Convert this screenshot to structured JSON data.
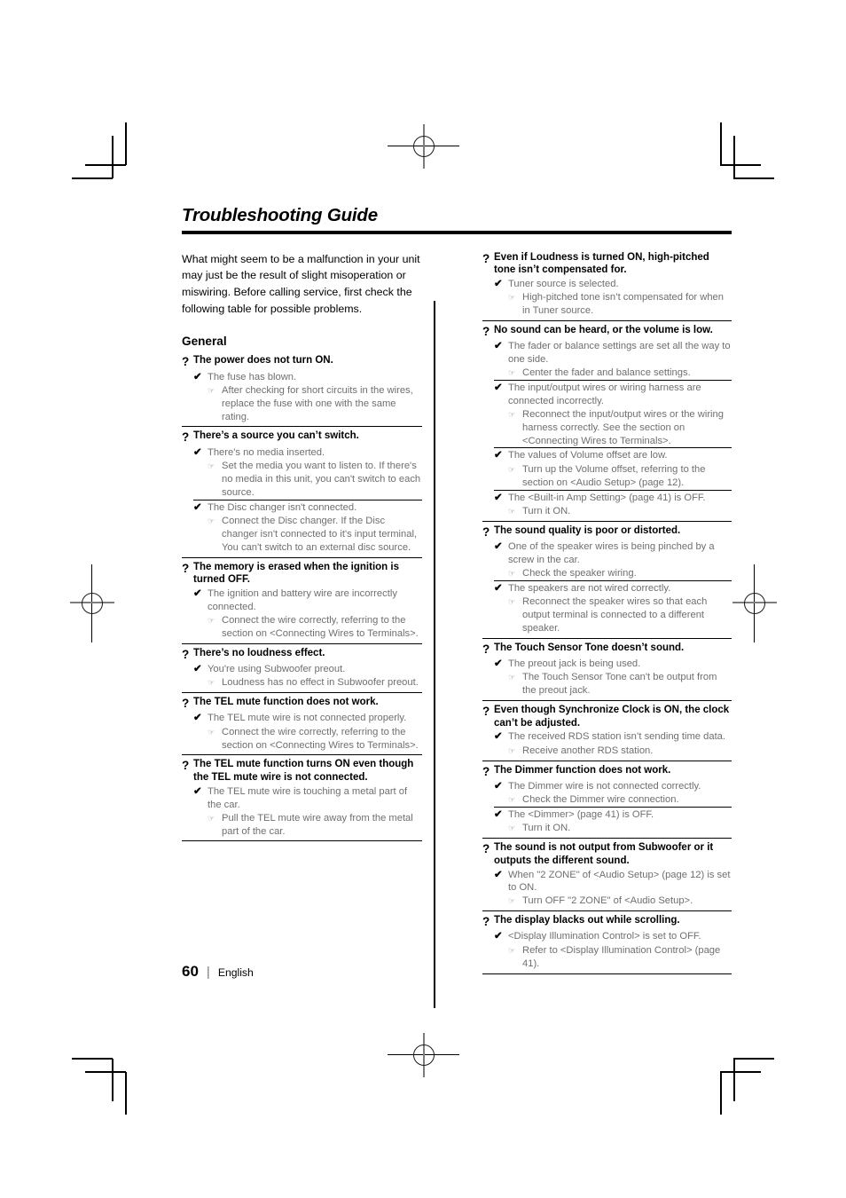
{
  "document": {
    "title": "Troubleshooting Guide",
    "intro": "What might seem to be a malfunction in your unit may just be the result of slight misoperation or miswiring. Before calling service, first check the following table for possible problems.",
    "section_heading": "General",
    "marks": {
      "question": "?",
      "cause": "✔",
      "solution": "☞"
    }
  },
  "footer": {
    "page_number": "60",
    "separator": "|",
    "language": "English"
  },
  "left_column": [
    {
      "question": "The power does not turn ON.",
      "causes": [
        {
          "cause": "The fuse has blown.",
          "solutions": [
            "After checking for short circuits in the wires, replace the fuse with one with the same rating."
          ]
        }
      ]
    },
    {
      "question": "There’s a source you can’t switch.",
      "causes": [
        {
          "cause": "There's no media inserted.",
          "solutions": [
            "Set the media you want to listen to. If there's no media in this unit, you can't switch to each source."
          ]
        },
        {
          "cause": "The Disc changer isn't connected.",
          "solutions": [
            "Connect the Disc changer. If the Disc changer isn't connected to it's input terminal, You can't switch to an external disc source."
          ]
        }
      ]
    },
    {
      "question": "The memory is erased when the ignition is turned OFF.",
      "causes": [
        {
          "cause": "The ignition and battery wire are incorrectly connected.",
          "solutions": [
            "Connect the wire correctly, referring to the section on <Connecting Wires to Terminals>."
          ]
        }
      ]
    },
    {
      "question": "There’s no loudness effect.",
      "causes": [
        {
          "cause": "You're using Subwoofer preout.",
          "solutions": [
            "Loudness has no effect in Subwoofer preout."
          ]
        }
      ]
    },
    {
      "question": "The TEL mute function does not work.",
      "causes": [
        {
          "cause": "The TEL mute wire is not connected properly.",
          "solutions": [
            "Connect the wire correctly, referring to the section on <Connecting Wires to Terminals>."
          ]
        }
      ]
    },
    {
      "question": "The TEL mute function turns ON even though the TEL mute wire is not connected.",
      "causes": [
        {
          "cause": "The TEL mute wire is touching a metal part of the car.",
          "solutions": [
            "Pull the TEL mute wire away from the metal part of the car."
          ]
        }
      ]
    }
  ],
  "right_column": [
    {
      "question": "Even if Loudness is turned ON, high-pitched tone isn’t compensated for.",
      "causes": [
        {
          "cause": "Tuner source is selected.",
          "solutions": [
            "High-pitched tone isn’t compensated for when in Tuner source."
          ]
        }
      ]
    },
    {
      "question": "No sound can be heard, or the volume is low.",
      "causes": [
        {
          "cause": "The fader or balance settings are set all the way to one side.",
          "solutions": [
            "Center the fader and balance settings."
          ]
        },
        {
          "cause": "The input/output wires or wiring harness are connected incorrectly.",
          "solutions": [
            "Reconnect the input/output wires or the wiring harness correctly. See the section on <Connecting Wires to Terminals>."
          ]
        },
        {
          "cause": "The values of Volume offset are low.",
          "solutions": [
            "Turn up the Volume offset, referring to the section on <Audio Setup> (page 12)."
          ]
        },
        {
          "cause": "The <Built-in Amp Setting> (page 41) is OFF.",
          "solutions": [
            "Turn it ON."
          ]
        }
      ]
    },
    {
      "question": "The sound quality is poor or distorted.",
      "causes": [
        {
          "cause": "One of the speaker wires is being pinched by a screw in the car.",
          "solutions": [
            "Check the speaker wiring."
          ]
        },
        {
          "cause": "The speakers are not wired correctly.",
          "solutions": [
            "Reconnect the speaker wires so that each output terminal is connected to a different speaker."
          ]
        }
      ]
    },
    {
      "question": "The Touch Sensor Tone doesn’t sound.",
      "causes": [
        {
          "cause": "The preout jack is being used.",
          "solutions": [
            "The Touch Sensor Tone can't be output from the preout jack."
          ]
        }
      ]
    },
    {
      "question": "Even though Synchronize Clock is ON, the clock can’t be adjusted.",
      "causes": [
        {
          "cause": "The received RDS station isn’t sending time data.",
          "solutions": [
            "Receive another RDS station."
          ]
        }
      ]
    },
    {
      "question": "The Dimmer function does not work.",
      "causes": [
        {
          "cause": "The Dimmer wire is not connected correctly.",
          "solutions": [
            "Check the Dimmer wire connection."
          ]
        },
        {
          "cause": "The <Dimmer> (page 41) is OFF.",
          "solutions": [
            "Turn it ON."
          ]
        }
      ]
    },
    {
      "question": "The sound is not output from Subwoofer or it outputs the different sound.",
      "causes": [
        {
          "cause": "When \"2 ZONE\" of <Audio Setup> (page 12) is set to ON.",
          "solutions": [
            "Turn OFF \"2 ZONE\" of <Audio Setup>."
          ]
        }
      ]
    },
    {
      "question": "The display blacks out while scrolling.",
      "causes": [
        {
          "cause": "<Display Illumination Control> is set to OFF.",
          "solutions": [
            "Refer to <Display Illumination Control> (page 41)."
          ]
        }
      ]
    }
  ]
}
